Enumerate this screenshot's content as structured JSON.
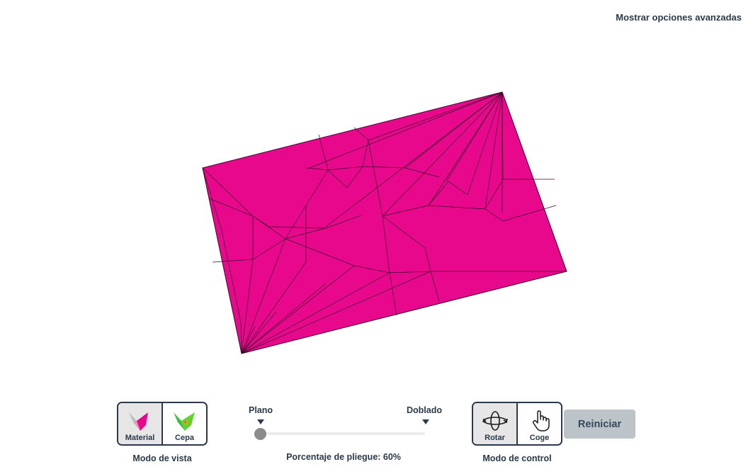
{
  "header": {
    "advanced_options_label": "Mostrar opciones avanzadas"
  },
  "colors": {
    "paper": "#e8088c",
    "crease": "#3a0a2a",
    "text": "#2b3a4a",
    "reset_bg": "#bcc3c9",
    "slider_thumb": "#8b8b8b"
  },
  "view_mode": {
    "caption": "Modo de vista",
    "options": [
      {
        "label": "Material",
        "icon": "material-icon",
        "active": true
      },
      {
        "label": "Cepa",
        "icon": "strain-icon",
        "active": false
      }
    ]
  },
  "fold_slider": {
    "start_label": "Plano",
    "end_label": "Doblado",
    "readout": "Porcentaje de pliegue: 60%",
    "value": 0.6
  },
  "control_mode": {
    "caption": "Modo de control",
    "options": [
      {
        "label": "Rotar",
        "icon": "rotate-icon",
        "active": true
      },
      {
        "label": "Coge",
        "icon": "grab-hand-icon",
        "active": false
      }
    ]
  },
  "reset_button": {
    "label": "Reiniciar"
  }
}
